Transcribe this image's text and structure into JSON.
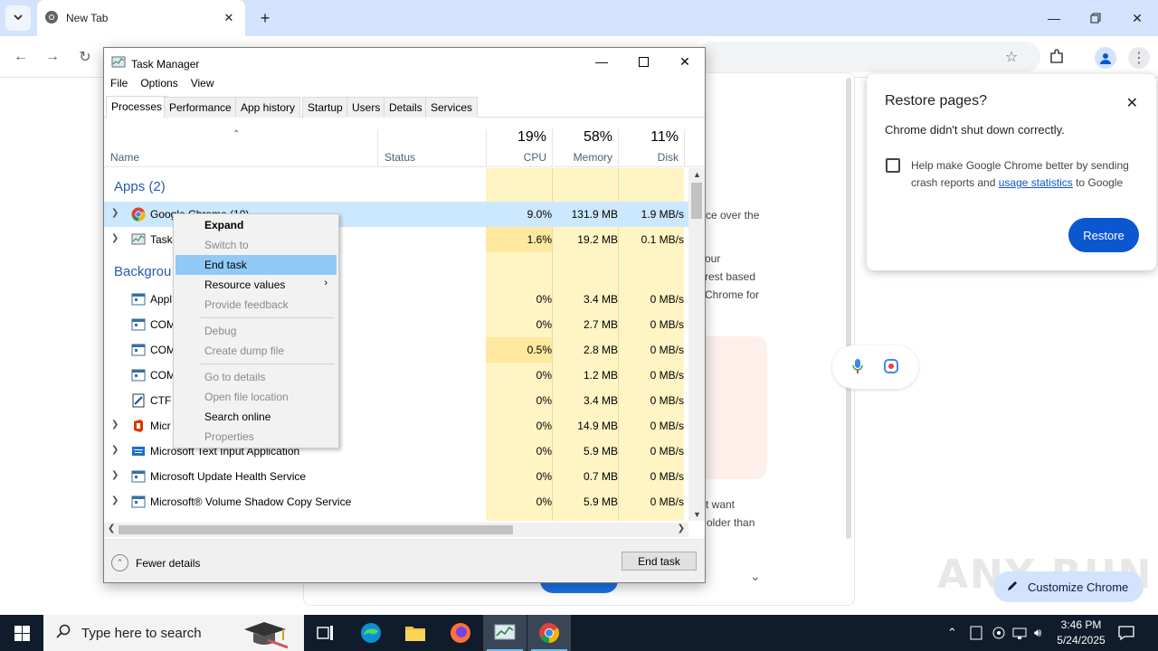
{
  "chrome": {
    "tab_title": "New Tab",
    "ntp_snippets": [
      "ce over the",
      "our",
      "rest based",
      "Chrome for",
      "t want",
      "older than"
    ],
    "customize_label": "Customize Chrome",
    "watermark": "ANY RUN"
  },
  "restore_popup": {
    "title": "Restore pages?",
    "message": "Chrome didn't shut down correctly.",
    "help_pre": "Help make Google Chrome better by sending crash reports and ",
    "help_link": "usage statistics",
    "help_post": " to Google",
    "restore_label": "Restore"
  },
  "task_manager": {
    "title": "Task Manager",
    "menu": [
      "File",
      "Options",
      "View"
    ],
    "tabs": [
      "Processes",
      "Performance",
      "App history",
      "Startup",
      "Users",
      "Details",
      "Services"
    ],
    "header": {
      "name": "Name",
      "status": "Status",
      "cpu_pct": "19%",
      "cpu": "CPU",
      "mem_pct": "58%",
      "mem": "Memory",
      "disk_pct": "11%",
      "disk": "Disk"
    },
    "groups": {
      "apps": "Apps (2)",
      "background": "Backgrou"
    },
    "rows": [
      {
        "name": "Google Chrome (10)",
        "cpu": "9.0%",
        "mem": "131.9 MB",
        "disk": "1.9 MB/s"
      },
      {
        "name": "Task",
        "cpu": "1.6%",
        "mem": "19.2 MB",
        "disk": "0.1 MB/s"
      },
      {
        "name": "Appl",
        "cpu": "0%",
        "mem": "3.4 MB",
        "disk": "0 MB/s"
      },
      {
        "name": "COM",
        "cpu": "0%",
        "mem": "2.7 MB",
        "disk": "0 MB/s"
      },
      {
        "name": "COM",
        "cpu": "0.5%",
        "mem": "2.8 MB",
        "disk": "0 MB/s"
      },
      {
        "name": "COM",
        "cpu": "0%",
        "mem": "1.2 MB",
        "disk": "0 MB/s"
      },
      {
        "name": "CTF l",
        "cpu": "0%",
        "mem": "3.4 MB",
        "disk": "0 MB/s"
      },
      {
        "name": "Micr",
        "cpu": "0%",
        "mem": "14.9 MB",
        "disk": "0 MB/s"
      },
      {
        "name": "Microsoft Text Input Application",
        "cpu": "0%",
        "mem": "5.9 MB",
        "disk": "0 MB/s"
      },
      {
        "name": "Microsoft Update Health Service",
        "cpu": "0%",
        "mem": "0.7 MB",
        "disk": "0 MB/s"
      },
      {
        "name": "Microsoft® Volume Shadow Copy Service",
        "cpu": "0%",
        "mem": "5.9 MB",
        "disk": "0 MB/s"
      }
    ],
    "fewer_details": "Fewer details",
    "end_task_button": "End task"
  },
  "context_menu": {
    "items": [
      {
        "label": "Expand"
      },
      {
        "label": "Switch to"
      },
      {
        "label": "End task"
      },
      {
        "label": "Resource values"
      },
      {
        "label": "Provide feedback"
      },
      {
        "label": "Debug"
      },
      {
        "label": "Create dump file"
      },
      {
        "label": "Go to details"
      },
      {
        "label": "Open file location"
      },
      {
        "label": "Search online"
      },
      {
        "label": "Properties"
      }
    ]
  },
  "taskbar": {
    "search_placeholder": "Type here to search",
    "time": "3:46 PM",
    "date": "5/24/2025"
  },
  "colors": {
    "accent": "#0b57d0",
    "tm_heat": "#fff4c4",
    "tm_heat_strong": "#ffe8a0",
    "selection": "#cce8ff",
    "ctx_highlight": "#91c9f7"
  },
  "icons": [
    "tab-search-icon",
    "chrome-icon",
    "close-icon",
    "plus-icon",
    "minimize-icon",
    "maximize-icon",
    "back-icon",
    "forward-icon",
    "reload-icon",
    "star-icon",
    "extensions-icon",
    "profile-icon",
    "menu-icon",
    "windows-icon",
    "search-icon",
    "task-view-icon",
    "edge-icon",
    "file-explorer-icon",
    "firefox-icon",
    "task-manager-icon"
  ]
}
